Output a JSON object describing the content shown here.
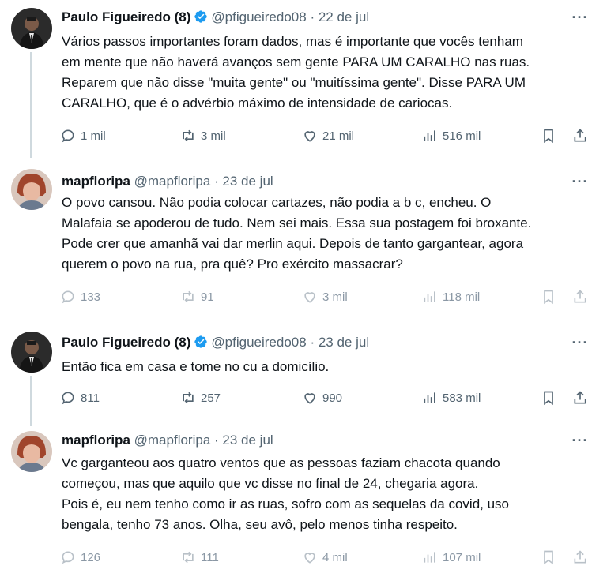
{
  "colors": {
    "verified": "#1d9bf0",
    "text": "#0f1419",
    "muted": "#536471",
    "thread_line": "#cfd9de"
  },
  "tweets": [
    {
      "name": "Paulo Figueiredo (8)",
      "verified": true,
      "handle": "@pfigueiredo08",
      "dot": "·",
      "date": "22 de jul",
      "text": "Vários passos importantes foram dados, mas é importante que vocês tenham\nem mente que não haverá avanços sem gente PARA UM CARALHO nas ruas.\nReparem que não disse \"muita gente\" ou \"muitíssima gente\". Disse PARA UM\nCARALHO, que é o advérbio máximo de intensidade de cariocas.",
      "replies": "1 mil",
      "retweets": "3 mil",
      "likes": "21 mil",
      "views": "516 mil"
    },
    {
      "name": "mapfloripa",
      "verified": false,
      "handle": "@mapfloripa",
      "dot": "·",
      "date": "23 de jul",
      "text": "O povo cansou. Não podia colocar cartazes,  não podia a b c, encheu. O\nMalafaia se apoderou de tudo. Nem sei mais. Essa sua postagem foi broxante.\nPode crer que amanhã vai dar merlin aqui. Depois de tanto gargantear, agora\nquerem o povo na rua, pra quê? Pro exército massacrar?",
      "replies": "133",
      "retweets": "91",
      "likes": "3 mil",
      "views": "118 mil"
    },
    {
      "name": "Paulo Figueiredo (8)",
      "verified": true,
      "handle": "@pfigueiredo08",
      "dot": "·",
      "date": "23 de jul",
      "text": "Então fica em casa e tome no cu a domicílio.",
      "replies": "811",
      "retweets": "257",
      "likes": "990",
      "views": "583 mil"
    },
    {
      "name": "mapfloripa",
      "verified": false,
      "handle": "@mapfloripa",
      "dot": "·",
      "date": "23 de jul",
      "text": "Vc garganteou aos quatro ventos que as pessoas faziam chacota quando\ncomeçou, mas que aquilo que vc disse no final de 24, chegaria agora.\nPois é, eu nem tenho como ir as ruas, sofro com as sequelas da covid, uso\nbengala, tenho 73 anos. Olha, seu avô, pelo menos tinha respeito.",
      "replies": "126",
      "retweets": "111",
      "likes": "4 mil",
      "views": "107 mil"
    }
  ]
}
